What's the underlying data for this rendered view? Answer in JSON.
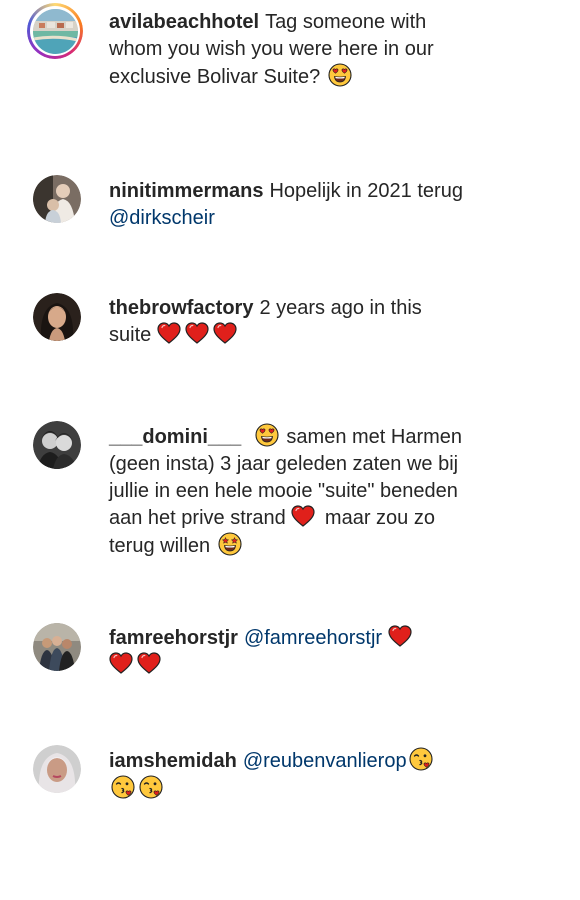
{
  "comments": [
    {
      "username": "avilabeachhotel",
      "text_1": "Tag someone with whom you wish you were here in our exclusive Bolivar Suite?",
      "avatar_icon": "hotel-aerial-photo"
    },
    {
      "username": "ninitimmermans",
      "text_1": "Hopelijk in 2021 terug",
      "mention": "@dirkscheir",
      "avatar_icon": "user-photo"
    },
    {
      "username": "thebrowfactory",
      "text_1": "2 years ago in this suite",
      "avatar_icon": "user-photo"
    },
    {
      "username": "___domini___",
      "text_1": "samen met Harmen (geen insta) 3 jaar geleden zaten we bij jullie in een hele mooie \"suite\" beneden aan het prive strand",
      "text_2": "maar zou zo terug willen",
      "avatar_icon": "user-photo"
    },
    {
      "username": "famreehorstjr",
      "mention": "@famreehorstjr",
      "avatar_icon": "user-photo"
    },
    {
      "username": "iamshemidah",
      "mention": "@reubenvanlierop",
      "avatar_icon": "user-photo"
    }
  ],
  "colors": {
    "text": "#262626",
    "mention": "#00376b",
    "heart": "#e0201b",
    "emoji": "#ffc83d"
  }
}
